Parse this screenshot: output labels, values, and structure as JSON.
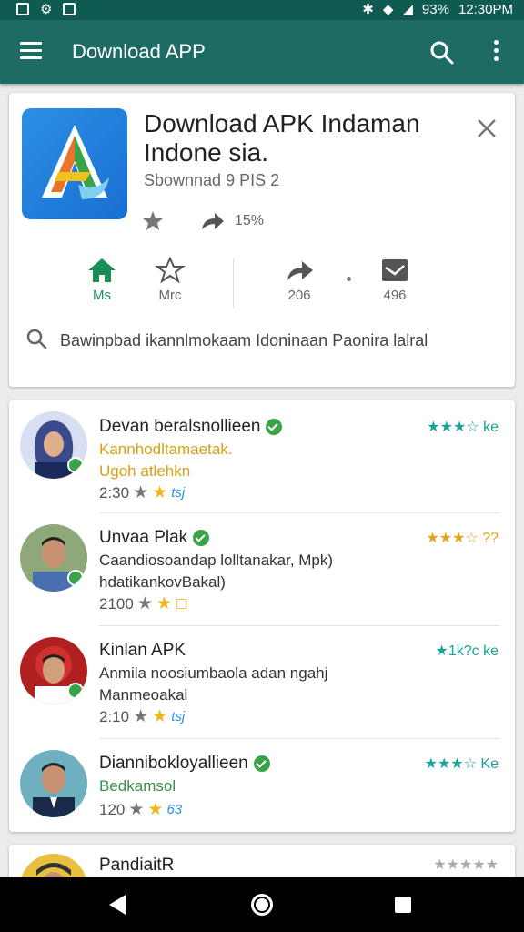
{
  "status_bar": {
    "battery": "93%",
    "time": "12:30PM"
  },
  "app_bar": {
    "title": "Download APP"
  },
  "top_card": {
    "app_title": "Download APK Indaman Indone sia.",
    "subtitle": "Sbownnad 9 PIS 2",
    "share_count": "15%",
    "actions": [
      {
        "label": "Ms",
        "icon": "home-icon"
      },
      {
        "label": "Mrc",
        "icon": "star-outline-icon"
      },
      {
        "label": "206",
        "icon": "share-icon"
      },
      {
        "label": "496",
        "icon": "image-icon"
      }
    ],
    "search_text": "Bawinpbad ikannlmokaam Idoninaan Paonira lalral"
  },
  "list": [
    {
      "name": "Devan beralsnollieen",
      "verified": true,
      "desc": [
        "Kannhodltamaetak.",
        "Ugoh atlehkn"
      ],
      "desc_color": "orange",
      "count": "2:30",
      "ic": "tsj",
      "rating": "★★★☆ ke",
      "rating_color": "teal"
    },
    {
      "name": "Unvaa Plak",
      "verified": true,
      "desc": [
        "Caandiosoandap lolltanakar, Mpk)",
        "hdatikankovBakal)"
      ],
      "desc_color": "dark",
      "count": "2100",
      "ic": "☐",
      "rating": "★★★☆ ??",
      "rating_color": "orange"
    },
    {
      "name": "Kinlan APK",
      "verified": false,
      "desc": [
        "Anmila noosiumbaola adan ngahj",
        "Manmeoakal"
      ],
      "desc_color": "dark",
      "count": "2:10",
      "ic": "tsj",
      "rating": "★1k?c ke",
      "rating_color": "teal"
    },
    {
      "name": "Diannibokloyallieen",
      "verified": true,
      "desc": [
        "Bedkamsol"
      ],
      "desc_color": "green",
      "count": "120",
      "ic": "63",
      "rating": "★★★☆ Ke",
      "rating_color": "teal"
    },
    {
      "name": "PandiaitR",
      "verified": false,
      "desc": [],
      "desc_color": "dark",
      "count": "",
      "ic": "",
      "rating": "★★★★★",
      "rating_color": "gray"
    }
  ],
  "colors": {
    "app_bar": "#1d6b63",
    "status_bar": "#0f5b52",
    "accent_green": "#1a8f55",
    "star_gold": "#f3b51a",
    "teal": "#1aa39a"
  }
}
